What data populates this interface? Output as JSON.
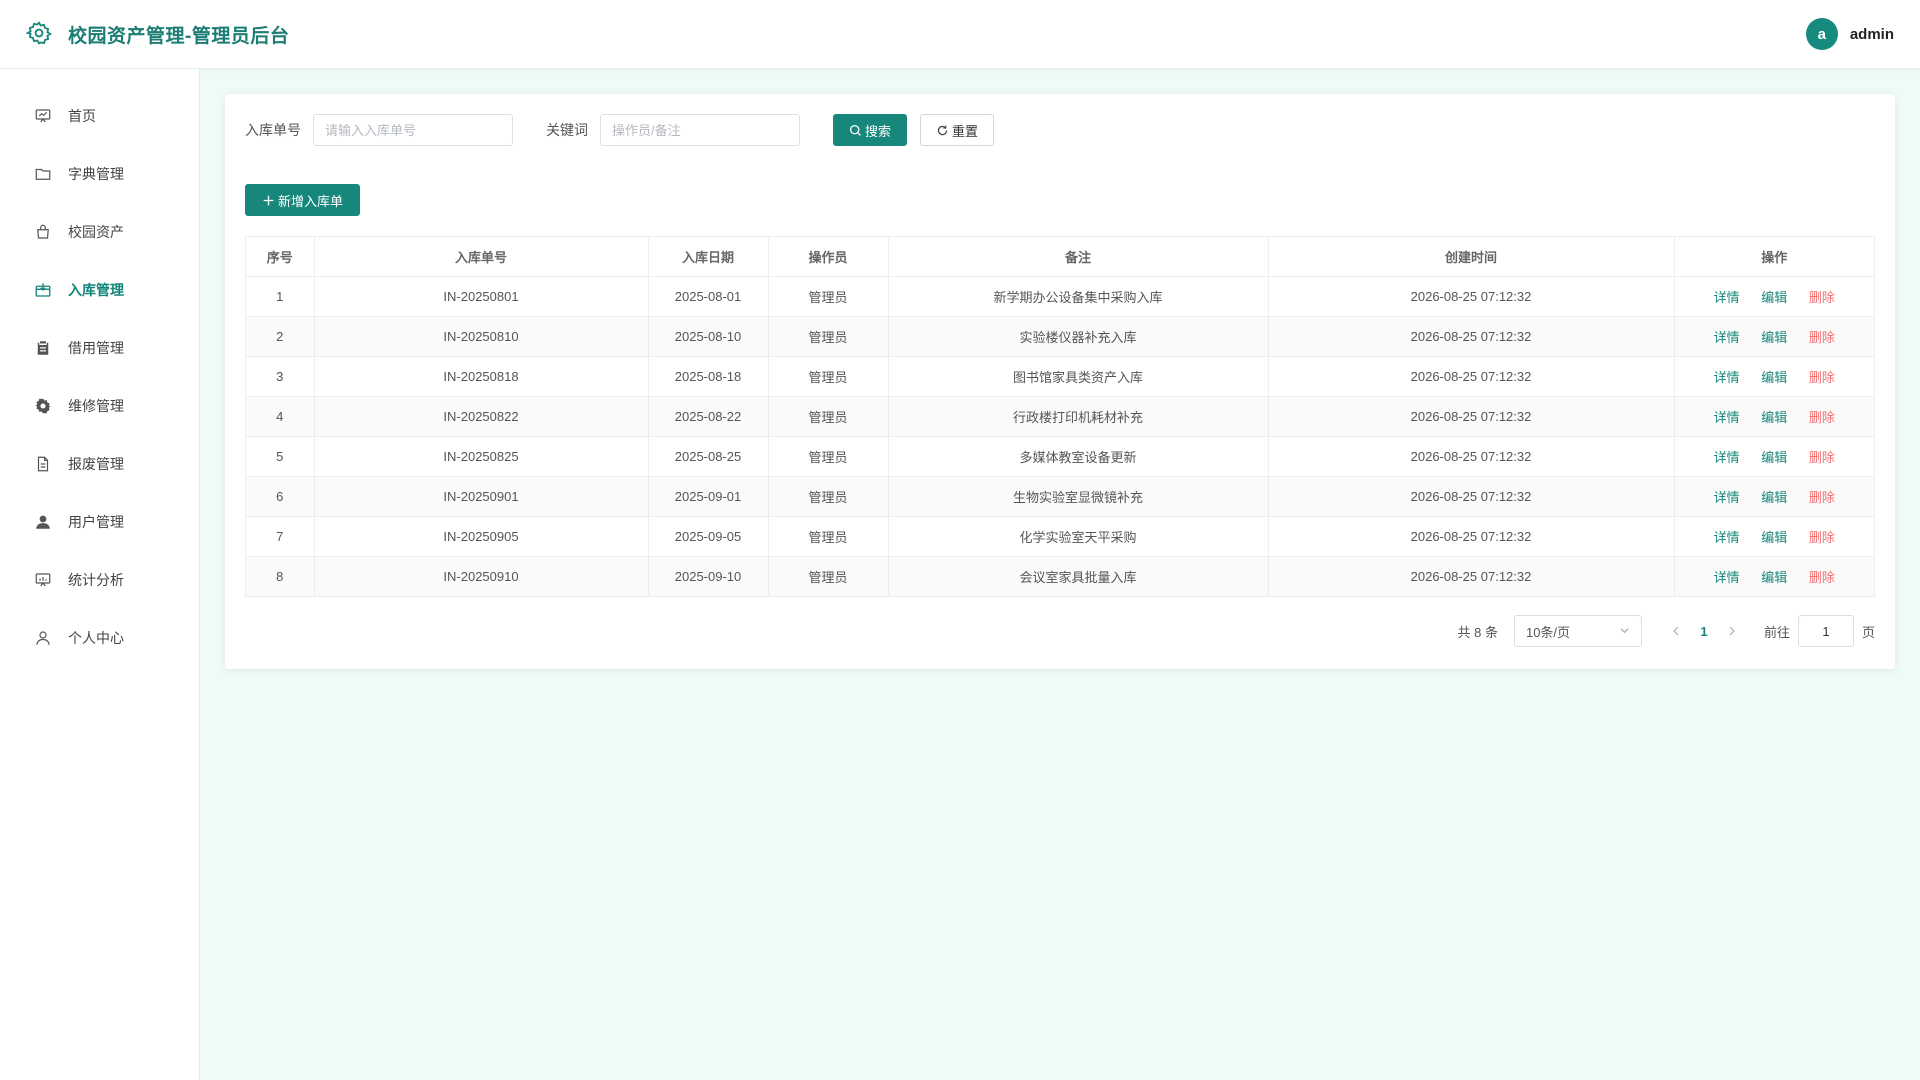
{
  "header": {
    "title": "校园资产管理-管理员后台",
    "user_initial": "a",
    "username": "admin",
    "accent": "#17877c"
  },
  "sidebar": {
    "items": [
      {
        "label": "首页",
        "icon": "presentation-board-icon",
        "active": false
      },
      {
        "label": "字典管理",
        "icon": "folder-icon",
        "active": false
      },
      {
        "label": "校园资产",
        "icon": "shopping-bag-icon",
        "active": false
      },
      {
        "label": "入库管理",
        "icon": "inbound-box-icon",
        "active": true
      },
      {
        "label": "借用管理",
        "icon": "clipboard-icon",
        "active": false
      },
      {
        "label": "维修管理",
        "icon": "gear-icon",
        "active": false
      },
      {
        "label": "报废管理",
        "icon": "document-icon",
        "active": false
      },
      {
        "label": "用户管理",
        "icon": "user-filled-icon",
        "active": false
      },
      {
        "label": "统计分析",
        "icon": "chart-board-icon",
        "active": false
      },
      {
        "label": "个人中心",
        "icon": "user-outline-icon",
        "active": false
      }
    ]
  },
  "search": {
    "order_label": "入库单号",
    "order_placeholder": "请输入入库单号",
    "keyword_label": "关键词",
    "keyword_placeholder": "操作员/备注",
    "search_button": "搜索",
    "reset_button": "重置"
  },
  "toolbar": {
    "add_button": "新增入库单"
  },
  "table": {
    "columns": [
      "序号",
      "入库单号",
      "入库日期",
      "操作员",
      "备注",
      "创建时间",
      "操作"
    ],
    "rows": [
      {
        "no": "1",
        "order": "IN-20250801",
        "date": "2025-08-01",
        "operator": "管理员",
        "remark": "新学期办公设备集中采购入库",
        "created": "2026-08-25 07:12:32"
      },
      {
        "no": "2",
        "order": "IN-20250810",
        "date": "2025-08-10",
        "operator": "管理员",
        "remark": "实验楼仪器补充入库",
        "created": "2026-08-25 07:12:32"
      },
      {
        "no": "3",
        "order": "IN-20250818",
        "date": "2025-08-18",
        "operator": "管理员",
        "remark": "图书馆家具类资产入库",
        "created": "2026-08-25 07:12:32"
      },
      {
        "no": "4",
        "order": "IN-20250822",
        "date": "2025-08-22",
        "operator": "管理员",
        "remark": "行政楼打印机耗材补充",
        "created": "2026-08-25 07:12:32"
      },
      {
        "no": "5",
        "order": "IN-20250825",
        "date": "2025-08-25",
        "operator": "管理员",
        "remark": "多媒体教室设备更新",
        "created": "2026-08-25 07:12:32"
      },
      {
        "no": "6",
        "order": "IN-20250901",
        "date": "2025-09-01",
        "operator": "管理员",
        "remark": "生物实验室显微镜补充",
        "created": "2026-08-25 07:12:32"
      },
      {
        "no": "7",
        "order": "IN-20250905",
        "date": "2025-09-05",
        "operator": "管理员",
        "remark": "化学实验室天平采购",
        "created": "2026-08-25 07:12:32"
      },
      {
        "no": "8",
        "order": "IN-20250910",
        "date": "2025-09-10",
        "operator": "管理员",
        "remark": "会议室家具批量入库",
        "created": "2026-08-25 07:12:32"
      }
    ],
    "actions": {
      "detail": "详情",
      "edit": "编辑",
      "delete": "删除"
    }
  },
  "pagination": {
    "total_text": "共 8 条",
    "page_size": "10条/页",
    "current_page": "1",
    "goto_label": "前往",
    "goto_value": "1",
    "page_suffix": "页"
  }
}
